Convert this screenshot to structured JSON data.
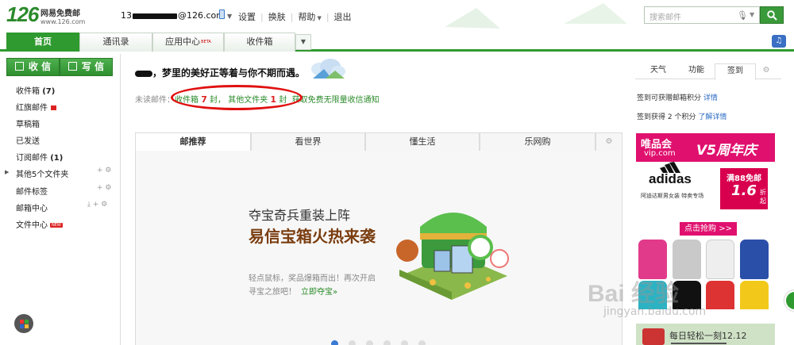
{
  "header": {
    "logo_number": "126",
    "logo_name": "网易免费邮",
    "logo_url": "www.126.com",
    "account_prefix": "13",
    "account_suffix": "@126.com",
    "links": [
      "设置",
      "换肤",
      "帮助",
      "退出"
    ],
    "help_has_dropdown": true,
    "search_placeholder": "搜索邮件"
  },
  "tabs": [
    {
      "label": "首页",
      "active": true
    },
    {
      "label": "通讯录",
      "active": false
    },
    {
      "label": "应用中心",
      "badge": "BETA",
      "active": false
    },
    {
      "label": "收件箱",
      "active": false
    }
  ],
  "sidebar": {
    "receive_button": "收 信",
    "compose_button": "写 信",
    "folders": [
      {
        "label": "收件箱",
        "count": "(7)"
      },
      {
        "label": "红旗邮件",
        "flag": true
      },
      {
        "label": "草稿箱"
      },
      {
        "label": "已发送"
      },
      {
        "label": "订阅邮件",
        "count": "(1)"
      },
      {
        "label": "其他5个文件夹",
        "expandable": true
      },
      {
        "label": "邮件标签"
      },
      {
        "label": "邮箱中心"
      },
      {
        "label": "文件中心",
        "badge": "NEW"
      }
    ]
  },
  "main": {
    "greeting": "，梦里的美好正等着与你不期而遇。",
    "unread_label": "未读邮件：",
    "inbox_text": "收件箱",
    "inbox_count": "7",
    "other_text": "其他文件夹",
    "other_count": "1",
    "unit": "封",
    "comma": "，",
    "notify_link": "获取免费无限量收信通知",
    "content_tabs": [
      "邮推荐",
      "看世界",
      "懂生活",
      "乐网购"
    ],
    "promo": {
      "subtitle": "夺宝奇兵重装上阵",
      "title": "易信宝箱火热来袭",
      "desc1": "轻点鼠标，奖品爆箱而出！再次开启",
      "desc2": "寻宝之旅吧！",
      "link": "立即夺宝»",
      "slides": 6,
      "active_slide": 1
    }
  },
  "right": {
    "tabs": [
      "天气",
      "功能",
      "签到"
    ],
    "active_tab": "签到",
    "info1": "签到可获赠邮箱积分",
    "info1_link": "详情",
    "info2": "签到获得 2 个积分",
    "info2_link": "了解详情",
    "ad": {
      "brand": "唯品会",
      "url": "vip.com",
      "anniversary": "V5周年庆",
      "adidas": "adidas",
      "note": "阿迪达斯男女装 特卖专场",
      "badge_a": "满88免邮",
      "badge_b": "1.6",
      "badge_c": "折起",
      "cta": "点击抢购 >>"
    },
    "ad2_text": "每日轻松一刻12.12"
  },
  "watermark": {
    "text": "Bai 经验",
    "url": "jingyan.baidu.com"
  },
  "colors": {
    "brand_green": "#2f9a2f",
    "highlight_red": "#e01010",
    "count_red": "#d22222",
    "vip_pink": "#e0106e"
  }
}
